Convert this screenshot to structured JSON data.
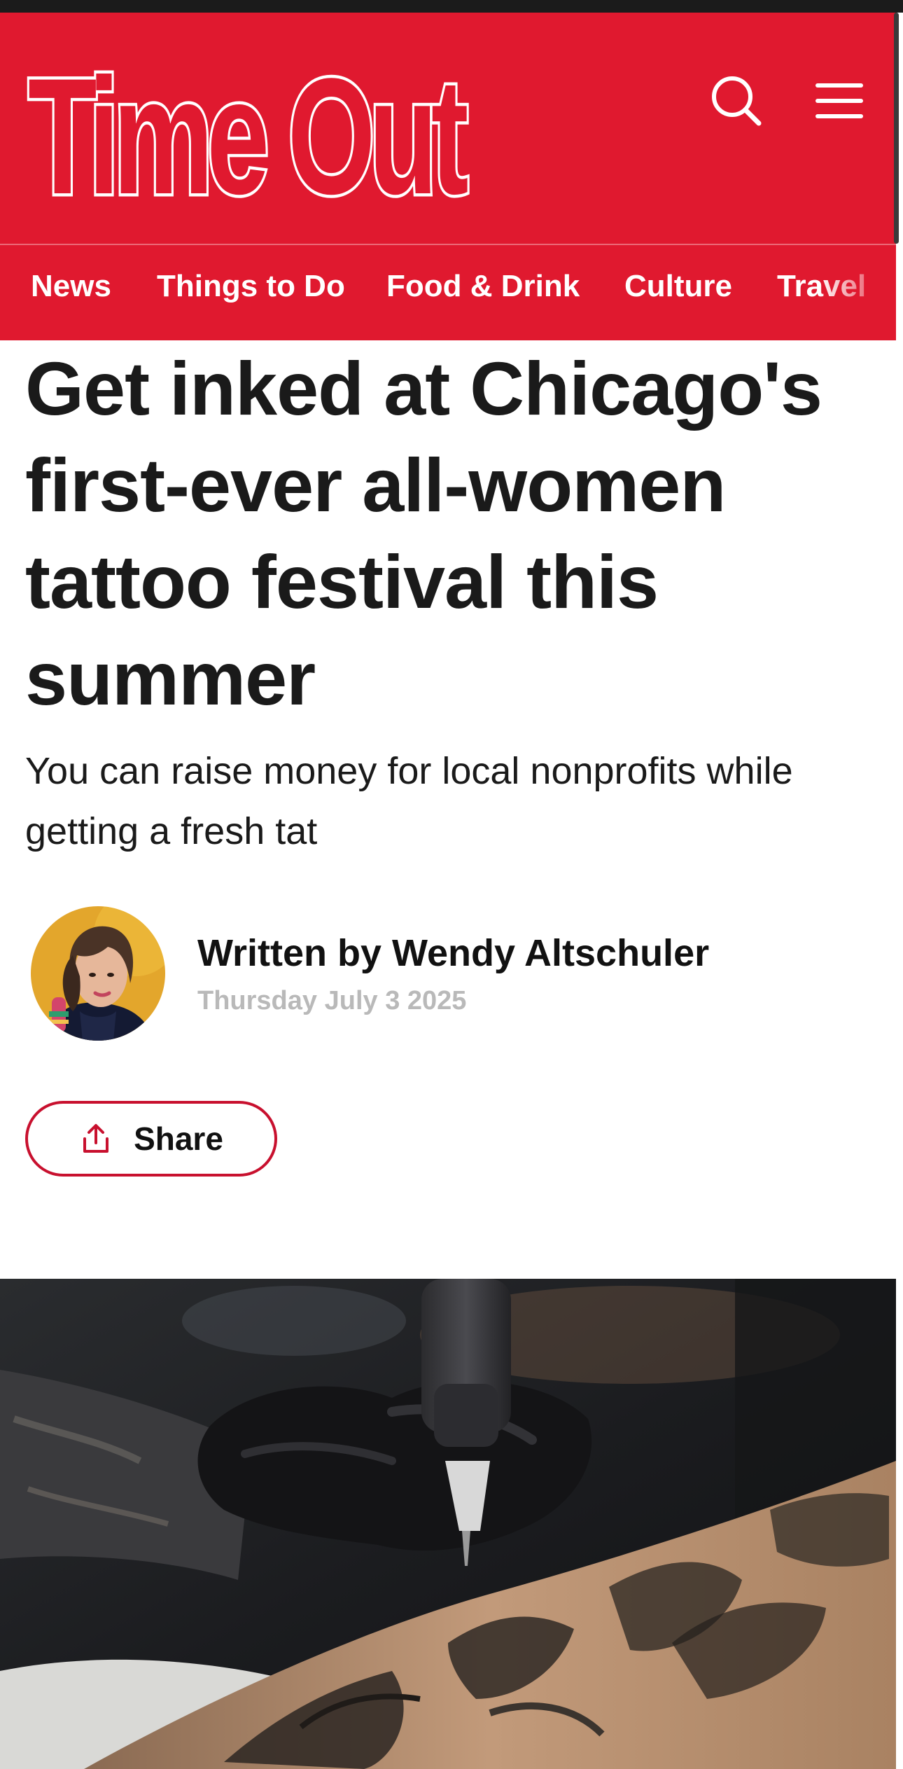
{
  "header": {
    "logo_text": "Time Out",
    "brand_color": "#e0192f",
    "search_icon": "search-icon",
    "menu_icon": "hamburger-menu-icon"
  },
  "nav": {
    "items": [
      {
        "label": "News"
      },
      {
        "label": "Things to Do"
      },
      {
        "label": "Food & Drink"
      },
      {
        "label": "Culture"
      },
      {
        "label": "Travel"
      }
    ]
  },
  "article": {
    "headline": "Get inked at Chicago's first-ever all-women tattoo festival this summer",
    "standfirst": "You can raise money for local nonprofits while getting a fresh tat",
    "byline": "Written by Wendy Altschuler",
    "date": "Thursday July 3 2025",
    "share_label": "Share",
    "share_icon": "share-upload-icon",
    "accent_color": "#c8102e"
  }
}
